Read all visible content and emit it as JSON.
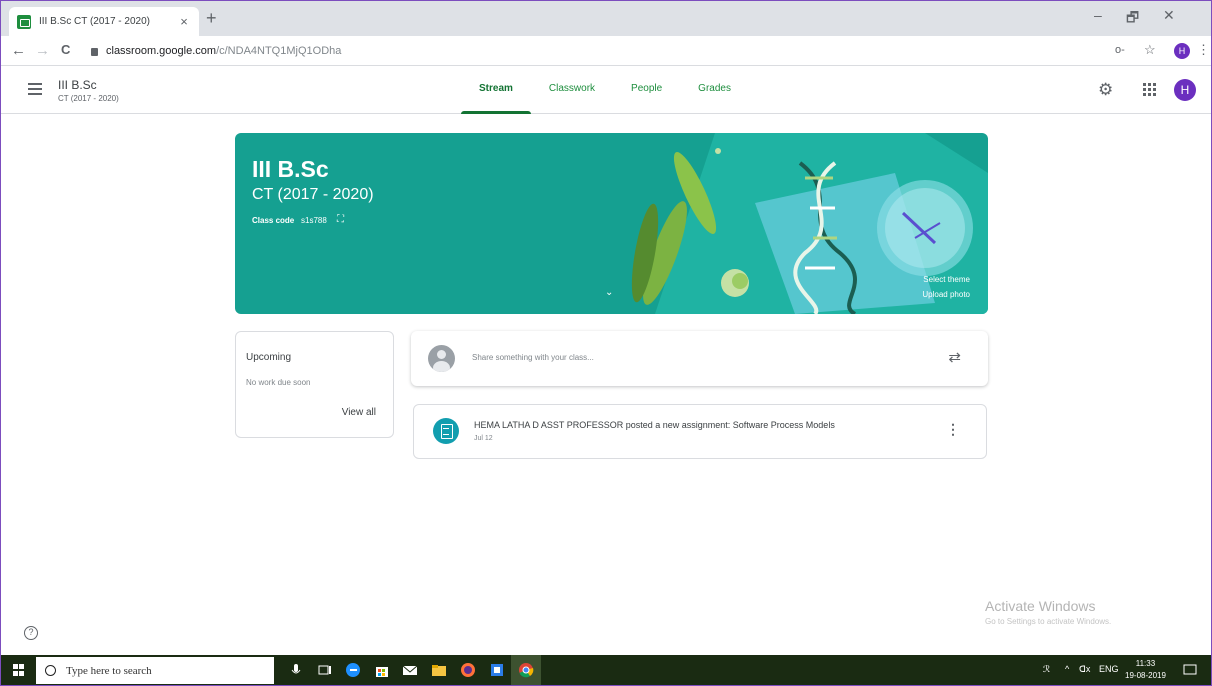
{
  "browser": {
    "tab_title": "III B.Sc CT (2017 - 2020)",
    "tab_close": "×",
    "new_tab": "+",
    "url_host": "classroom.google.com",
    "url_path": "/c/NDA4NTQ1MjQ1ODha",
    "profile_initial": "H",
    "window_min": "–",
    "window_restore": "🗗",
    "window_close": "✕",
    "back": "←",
    "forward": "→",
    "reload": "C",
    "key_icon": "o-",
    "star_icon": "☆",
    "menu_icon": "⋮"
  },
  "app": {
    "class_name": "III B.Sc",
    "class_section": "CT (2017 - 2020)",
    "tabs": [
      {
        "label": "Stream",
        "active": true
      },
      {
        "label": "Classwork",
        "active": false
      },
      {
        "label": "People",
        "active": false
      },
      {
        "label": "Grades",
        "active": false
      }
    ],
    "settings_icon": "⚙",
    "user_initial": "H"
  },
  "banner": {
    "title": "III B.Sc",
    "subtitle": "CT (2017 - 2020)",
    "class_code_label": "Class code",
    "class_code": "s1s788",
    "expand_icon": "⛶",
    "chevron": "⌄",
    "select_theme": "Select theme",
    "upload_photo": "Upload photo",
    "color": "#15a091"
  },
  "upcoming": {
    "title": "Upcoming",
    "empty_text": "No work due soon",
    "view_all": "View all"
  },
  "share": {
    "placeholder": "Share something with your class...",
    "repost_icon": "⇄"
  },
  "posts": [
    {
      "text": "HEMA LATHA D ASST PROFESSOR posted a new assignment: Software Process Models",
      "date": "Jul 12",
      "more_icon": "⋮"
    }
  ],
  "help_icon": "?",
  "watermark": {
    "line1": "Activate Windows",
    "line2": "Go to Settings to activate Windows."
  },
  "taskbar": {
    "search_placeholder": "Type here to search",
    "tray_lang": "ENG",
    "time": "11:33",
    "date": "19-08-2019",
    "tray_up": "^",
    "tray_volume": "ᗡx"
  }
}
